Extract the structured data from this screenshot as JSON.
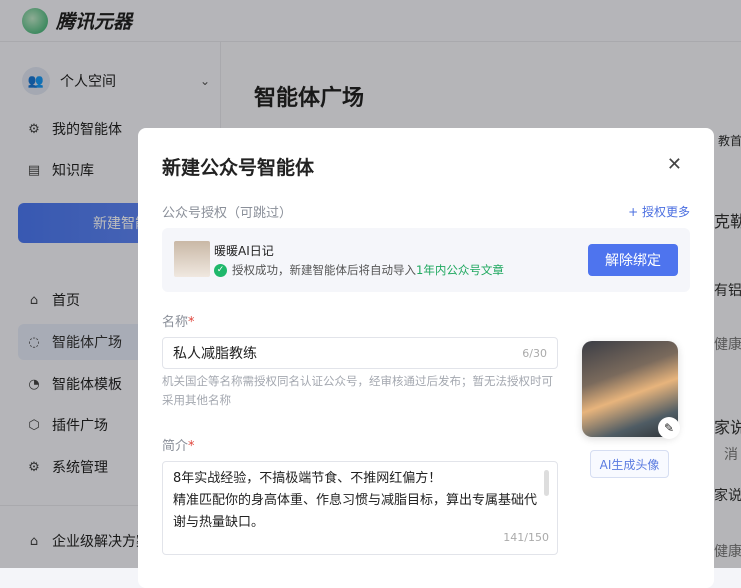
{
  "header": {
    "brand": "腾讯元器"
  },
  "sidebar": {
    "space": "个人空间",
    "my_agents": "我的智能体",
    "knowledge": "知识库",
    "new_button": "新建智能体",
    "items": [
      {
        "label": "首页",
        "icon": "home-icon"
      },
      {
        "label": "智能体广场",
        "icon": "plaza-icon"
      },
      {
        "label": "智能体模板",
        "icon": "template-icon"
      },
      {
        "label": "插件广场",
        "icon": "plugin-icon"
      },
      {
        "label": "系统管理",
        "icon": "gear-icon"
      }
    ],
    "enterprise": "企业级解决方案"
  },
  "main": {
    "title": "智能体广场",
    "peek": [
      "教首",
      "克勒",
      "有铝",
      "健康",
      "家说",
      "消",
      "家说",
      "健康"
    ]
  },
  "modal": {
    "title": "新建公众号智能体",
    "auth_section": "公众号授权（可跳过）",
    "auth_more": "+ 授权更多",
    "account_name": "暖暖AI日记",
    "auth_status": "授权成功，新建智能体后将自动导入",
    "auth_highlight": "1年内公众号文章",
    "unbind_button": "解除绑定",
    "name_label": "名称",
    "name_value": "私人减脂教练",
    "name_count": "6/30",
    "name_hint": "机关国企等名称需授权同名认证公众号，经审核通过后发布；暂无法授权时可采用其他名称",
    "intro_label": "简介",
    "intro_value": "8年实战经验，不搞极端节食、不推网红偏方！\n精准匹配你的身高体重、作息习惯与减脂目标，算出专属基础代谢与热量缺口。",
    "intro_count": "141/150",
    "ai_avatar_button": "AI生成头像"
  }
}
